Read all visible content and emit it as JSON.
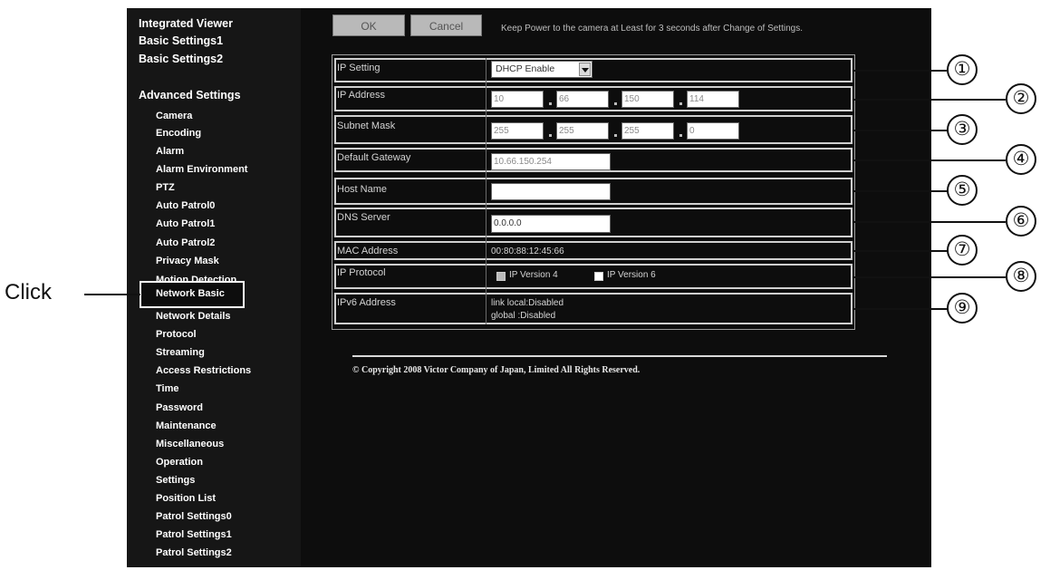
{
  "sidebar": {
    "top_items": [
      "Integrated Viewer",
      "Basic Settings1",
      "Basic Settings2"
    ],
    "section_title": "Advanced Settings",
    "items": [
      "Camera",
      "Encoding",
      "Alarm",
      "Alarm Environment",
      "PTZ",
      "Auto Patrol0",
      "Auto Patrol1",
      "Auto Patrol2",
      "Privacy Mask",
      "Motion Detection",
      "Network Basic",
      "Network Details",
      "Protocol",
      "Streaming",
      "Access Restrictions",
      "Time",
      "Password",
      "Maintenance",
      "Miscellaneous",
      "Operation",
      "Settings",
      "Position List",
      "Patrol Settings0",
      "Patrol Settings1",
      "Patrol Settings2"
    ],
    "selected": "Network Basic"
  },
  "annotation": {
    "click_label": "Click"
  },
  "toolbar": {
    "ok_label": "OK",
    "cancel_label": "Cancel",
    "notice": "Keep Power to the camera at Least for 3 seconds after Change of Settings."
  },
  "form": {
    "ip_setting": {
      "label": "IP Setting",
      "value": "DHCP Enable"
    },
    "ip_address": {
      "label": "IP Address",
      "octets": [
        "10",
        "66",
        "150",
        "114"
      ]
    },
    "subnet_mask": {
      "label": "Subnet Mask",
      "octets": [
        "255",
        "255",
        "255",
        "0"
      ]
    },
    "default_gateway": {
      "label": "Default Gateway",
      "value": "10.66.150.254"
    },
    "host_name": {
      "label": "Host Name",
      "value": ""
    },
    "dns_server": {
      "label": "DNS Server",
      "value": "0.0.0.0"
    },
    "mac_address": {
      "label": "MAC Address",
      "value": "00:80:88:12:45:66"
    },
    "ip_protocol": {
      "label": "IP Protocol",
      "v4_label": "IP Version 4",
      "v6_label": "IP Version 6",
      "v4_checked": true,
      "v6_checked": false
    },
    "ipv6_address": {
      "label": "IPv6 Address",
      "link_local": "link local:Disabled",
      "global": "global :Disabled"
    }
  },
  "callouts": [
    "①",
    "②",
    "③",
    "④",
    "⑤",
    "⑥",
    "⑦",
    "⑧",
    "⑨"
  ],
  "footer": {
    "copyright": "© Copyright 2008 Victor Company of Japan, Limited All Rights Reserved."
  }
}
